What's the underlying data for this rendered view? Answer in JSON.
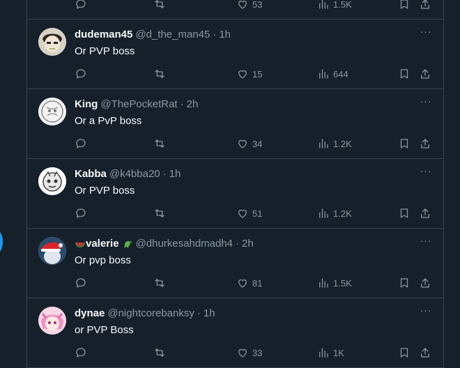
{
  "top_partial": {
    "like_count": "53",
    "view_count": "1.5K"
  },
  "tweets": [
    {
      "name": "dudeman45",
      "handle": "@d_the_man45",
      "time": "1h",
      "text": "Or PVP boss",
      "likes": "15",
      "views": "644"
    },
    {
      "name": "King",
      "handle": "@ThePocketRat",
      "time": "2h",
      "text": "Or a PvP boss",
      "likes": "34",
      "views": "1.2K"
    },
    {
      "name": "Kabba",
      "handle": "@k4bba20",
      "time": "1h",
      "text": "Or PVP boss",
      "likes": "51",
      "views": "1.2K"
    },
    {
      "name": "valerie",
      "handle": "@dhurkesahdmadh4",
      "time": "2h",
      "text": "Or pvp boss",
      "likes": "81",
      "views": "1.5K"
    },
    {
      "name": "dynae",
      "handle": "@nightcorebanksy",
      "time": "1h",
      "text": "or PVP Boss",
      "likes": "33",
      "views": "1K"
    }
  ],
  "separator": "·",
  "more_glyph": "···",
  "colors": {
    "background": "#15202b",
    "border": "#38444d",
    "muted": "#8b98a5",
    "accent": "#1d9bf0"
  }
}
